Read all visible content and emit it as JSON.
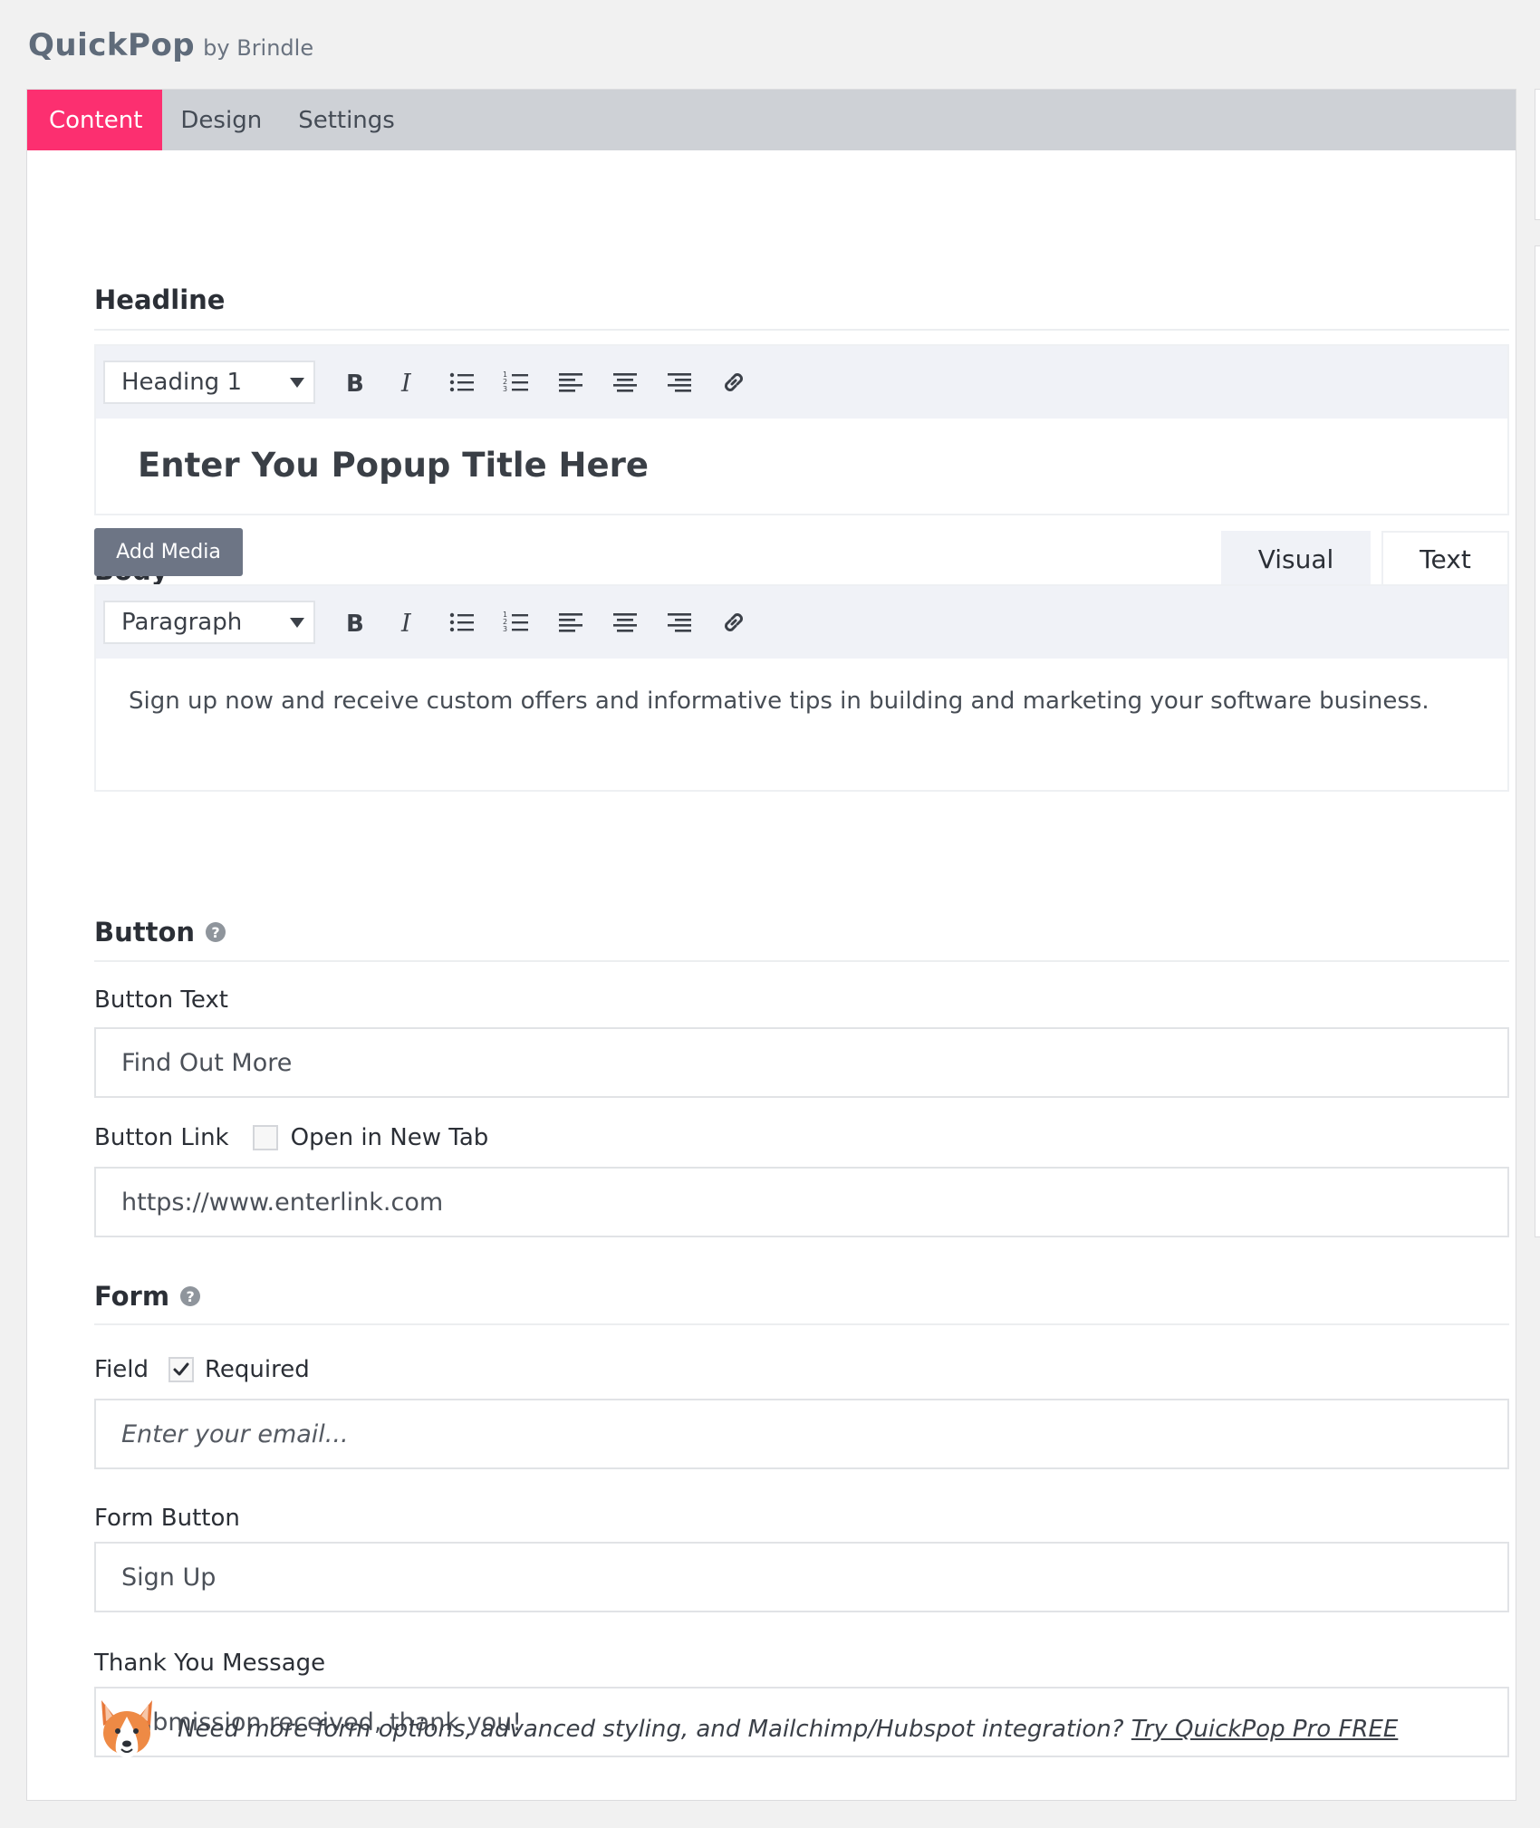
{
  "app": {
    "name": "QuickPop",
    "byline": "by Brindle"
  },
  "tabs": [
    {
      "label": "Content",
      "active": true
    },
    {
      "label": "Design",
      "active": false
    },
    {
      "label": "Settings",
      "active": false
    }
  ],
  "headline": {
    "section_title": "Headline",
    "format": "Heading 1",
    "text": "Enter You Popup Title Here"
  },
  "body": {
    "section_title": "Body",
    "add_media_label": "Add Media",
    "mode_tabs": [
      {
        "label": "Visual",
        "active": true
      },
      {
        "label": "Text",
        "active": false
      }
    ],
    "format": "Paragraph",
    "text": "Sign up now and receive custom offers and informative tips in building and marketing your software business."
  },
  "toolbar_icons": [
    "bold-icon",
    "italic-icon",
    "bullet-list-icon",
    "numbered-list-icon",
    "align-left-icon",
    "align-center-icon",
    "align-right-icon",
    "link-icon"
  ],
  "button_section": {
    "title": "Button",
    "button_text_label": "Button Text",
    "button_text_value": "Find Out More",
    "button_link_label": "Button Link",
    "open_new_tab_label": "Open in New Tab",
    "open_new_tab_checked": false,
    "button_link_value": "https://www.enterlink.com"
  },
  "form_section": {
    "title": "Form",
    "field_label": "Field",
    "required_label": "Required",
    "required_checked": true,
    "field_placeholder": "Enter your email...",
    "form_button_label": "Form Button",
    "form_button_value": "Sign Up",
    "thank_you_label": "Thank You Message",
    "thank_you_value": "Submission received, thank you!"
  },
  "promo": {
    "text": "Need more form options, advanced styling, and Mailchimp/Hubspot integration?",
    "link_text": "Try QuickPop Pro FREE"
  },
  "colors": {
    "accent": "#fc2f70",
    "tabbar": "#ced1d6",
    "add_media": "#6d7585"
  }
}
